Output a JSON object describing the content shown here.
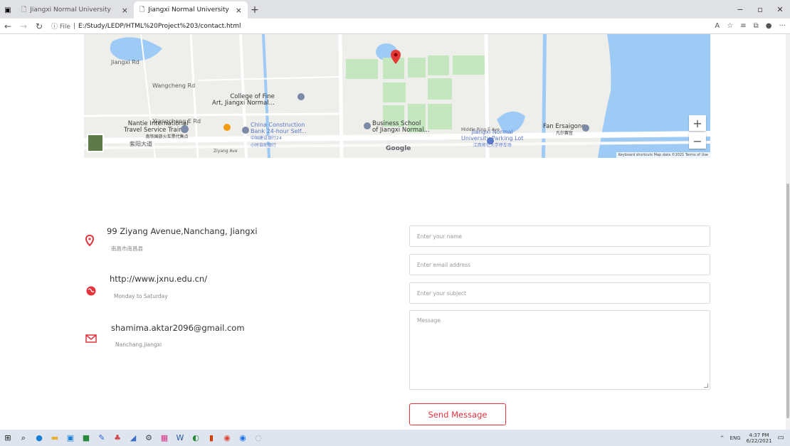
{
  "browser": {
    "tabs": [
      {
        "label": "Jiangxi Normal University",
        "close": "×"
      },
      {
        "label": "Jiangxi Normal University",
        "close": "×"
      }
    ],
    "new_tab": "+",
    "window_controls": [
      "−",
      "▫",
      "✕"
    ],
    "address": {
      "prefix": "ⓘ File",
      "separator": "|",
      "url": "E:/Study/LEDP/HTML%20Project%203/contact.html"
    }
  },
  "map": {
    "labels": {
      "college": "College of Fine",
      "college2": "Art, Jiangxi Normal...",
      "nantie": "Nantie International",
      "nantie2": "Travel Service Train...",
      "nantie3": "南铁国旅火车票代售点",
      "bank": "China Construction",
      "bank2": "Bank 24-hour Self...",
      "bank3": "中国建设银行24",
      "bank4": "小时自助银行",
      "business": "Business School",
      "business2": "of Jiangxi Normal...",
      "parking": "Jiangxi Normal",
      "parking2": "University Parking Lot",
      "parking3": "江西师范大学停车场",
      "fan": "Fan Ersaigong",
      "fan2": "凡尔赛宫",
      "ziyang_cn": "紫阳大道",
      "ziyang": "Ziyang Ave",
      "wangcheng": "Wangcheng Rd",
      "xiangcheng": "Xiangcheng E Rd",
      "jiangxi_rd": "Jiangxi Rd",
      "middle": "Middle Ring E Ave",
      "google": "Google",
      "attribution": "Keyboard shortcuts  Map data ©2021  Terms of Use"
    },
    "zoom_in": "+",
    "zoom_out": "−"
  },
  "contact": {
    "items": [
      {
        "title": "99 Ziyang Avenue,Nanchang, Jiangxi",
        "subtitle": "南昌市南昌县",
        "icon": "location-pin-icon"
      },
      {
        "title": "http://www.jxnu.edu.cn/",
        "subtitle": "Monday to Saturday",
        "icon": "globe-icon"
      },
      {
        "title": "shamima.aktar2096@gmail.com",
        "subtitle": "Nanchang,jiangxi",
        "icon": "mail-icon"
      }
    ]
  },
  "form": {
    "name_placeholder": "Enter your name",
    "email_placeholder": "Enter email address",
    "subject_placeholder": "Enter your subject",
    "message_placeholder": "Message",
    "send_label": "Send Message"
  },
  "taskbar": {
    "lang": "ENG",
    "time": "4:37 PM",
    "date": "6/22/2021",
    "tray_arrow": "^"
  },
  "colors": {
    "accent": "#e8323c",
    "map_green": "#c5e7c0",
    "map_water": "#9ecbf5"
  }
}
